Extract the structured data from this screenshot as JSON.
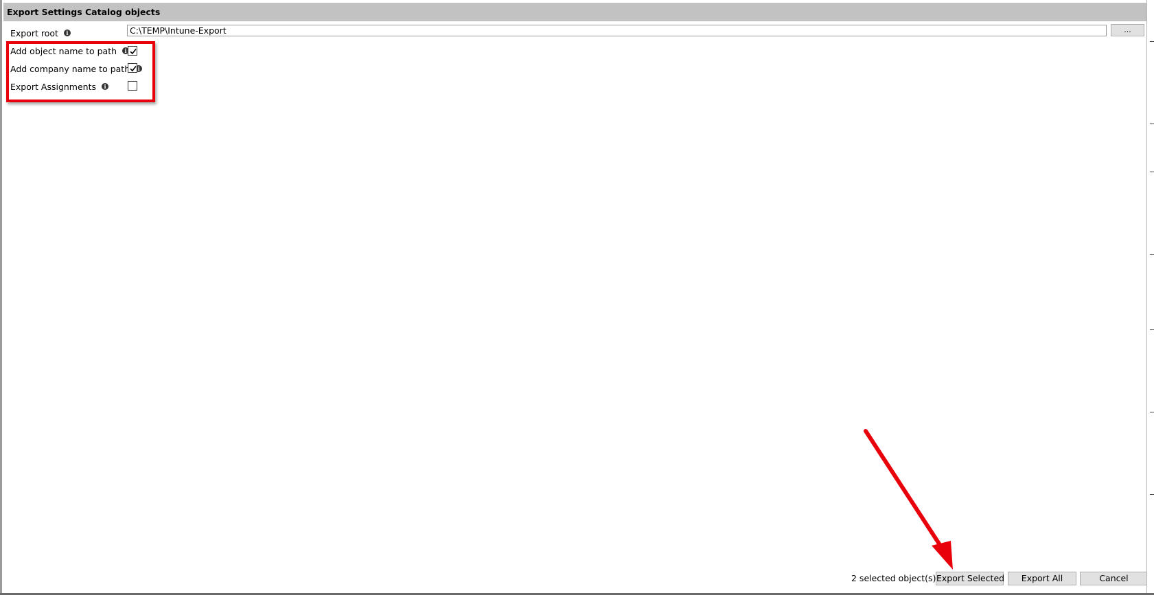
{
  "panel": {
    "title": "Export Settings Catalog objects"
  },
  "settings": {
    "export_root_label": "Export root",
    "export_root_value": "C:\\TEMP\\Intune-Export",
    "browse_label": "...",
    "options": [
      {
        "label": "Add object name to path",
        "checked": true
      },
      {
        "label": "Add company name to path",
        "checked": true
      },
      {
        "label": "Export Assignments",
        "checked": false
      }
    ]
  },
  "footer": {
    "status": "2 selected object(s)",
    "export_selected_label": "Export Selected",
    "export_all_label": "Export All",
    "cancel_label": "Cancel"
  },
  "icons": {
    "info": "info-icon",
    "check": "checkmark-icon"
  },
  "colors": {
    "title_bar": "#c2c2c2",
    "annotation_red": "#e8000b",
    "button_bg": "#e1e1e1"
  }
}
